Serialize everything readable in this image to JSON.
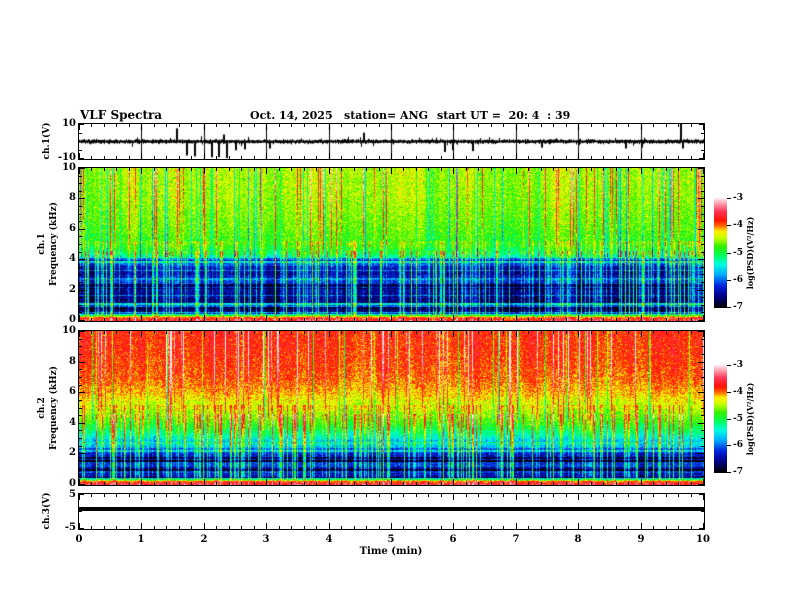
{
  "header": {
    "title": "VLF Spectra",
    "date": "Oct. 14, 2025",
    "station": "station= ANG",
    "start_ut": "start UT =  20: 4  : 39"
  },
  "xaxis": {
    "label": "Time (min)",
    "ticks": [
      "0",
      "1",
      "2",
      "3",
      "4",
      "5",
      "6",
      "7",
      "8",
      "9",
      "10"
    ]
  },
  "panels": {
    "ch1_wave": {
      "label": "ch.1(V)",
      "ytick_top": "10",
      "ytick_bottom": "-10"
    },
    "spec1": {
      "channel": "ch.1",
      "ylabel": "Frequency (kHz)",
      "yticks": [
        "10",
        "8",
        "6",
        "4",
        "2",
        "0"
      ]
    },
    "spec2": {
      "channel": "ch.2",
      "ylabel": "Frequency (kHz)",
      "yticks": [
        "10",
        "8",
        "6",
        "4",
        "2",
        "0"
      ]
    },
    "ch3": {
      "label": "ch.3(V)",
      "ytick_top": "5",
      "ytick_bottom": "-5"
    }
  },
  "colorbar": {
    "label": "log(PSD)(V²/Hz)",
    "ticks": [
      "-3",
      "-4",
      "-5",
      "-6",
      "-7"
    ],
    "value_range": [
      -7,
      -3
    ],
    "stops": [
      [
        0,
        "#000000"
      ],
      [
        0.1,
        "#000080"
      ],
      [
        0.2,
        "#0022dd"
      ],
      [
        0.3,
        "#00aaff"
      ],
      [
        0.4,
        "#00ffdd"
      ],
      [
        0.48,
        "#00ff55"
      ],
      [
        0.56,
        "#33ee00"
      ],
      [
        0.64,
        "#ccff00"
      ],
      [
        0.7,
        "#ffee00"
      ],
      [
        0.75,
        "#ff6600"
      ],
      [
        0.8,
        "#ff1100"
      ],
      [
        0.88,
        "#ff3355"
      ],
      [
        0.95,
        "#ff99aa"
      ],
      [
        1,
        "#ffe8ee"
      ]
    ]
  },
  "chart_data": [
    {
      "name": "ch1-waveform",
      "type": "line",
      "ylabel": "ch.1(V)",
      "xlim": [
        0,
        10
      ],
      "ylim": [
        -10,
        10
      ],
      "noise_amplitude_v": 1.4,
      "minute_gridlines": [
        1,
        2,
        3,
        4,
        5,
        6,
        7,
        8,
        9
      ],
      "spikes": [
        {
          "t": 1.55,
          "v": 7.5
        },
        {
          "t": 1.72,
          "v": -8
        },
        {
          "t": 1.85,
          "v": -8.5
        },
        {
          "t": 2.12,
          "v": -9
        },
        {
          "t": 2.22,
          "v": -9
        },
        {
          "t": 2.3,
          "v": 4
        },
        {
          "t": 2.35,
          "v": -9.5
        },
        {
          "t": 2.5,
          "v": -5
        },
        {
          "t": 2.65,
          "v": -4.5
        },
        {
          "t": 3.05,
          "v": -4
        },
        {
          "t": 4.55,
          "v": 5
        },
        {
          "t": 5.85,
          "v": -6
        },
        {
          "t": 5.97,
          "v": -5
        },
        {
          "t": 6.3,
          "v": -5.5
        },
        {
          "t": 7.4,
          "v": -3.5
        },
        {
          "t": 8.75,
          "v": -4
        },
        {
          "t": 9.0,
          "v": -3.5
        },
        {
          "t": 9.63,
          "v": 10
        },
        {
          "t": 9.66,
          "v": -4
        }
      ]
    },
    {
      "name": "ch1-spectrogram",
      "type": "heatmap",
      "xlim": [
        0,
        10
      ],
      "ylim": [
        0,
        10
      ],
      "value_range": [
        -7,
        -3
      ],
      "units": "log(PSD)(V²/Hz)",
      "seed": 11,
      "noise": 0.42,
      "dark_streak_p": 0.08,
      "banded_region_khz": [
        0.45,
        4.1
      ],
      "freq_profile": [
        [
          0,
          -3.7
        ],
        [
          0.22,
          -4.0
        ],
        [
          0.5,
          -6.1
        ],
        [
          1,
          -6.45
        ],
        [
          2,
          -6.5
        ],
        [
          3,
          -6.35
        ],
        [
          3.9,
          -5.9
        ],
        [
          4.4,
          -5.2
        ],
        [
          5,
          -4.85
        ],
        [
          6,
          -4.7
        ],
        [
          8,
          -4.55
        ],
        [
          10,
          -4.5
        ]
      ],
      "description": "Green/yellow background 4-10 kHz with red sferic streaks; dark blue banded region 0.5-4 kHz with cyan vertical streaks; bright band below 0.3 kHz"
    },
    {
      "name": "ch2-spectrogram",
      "type": "heatmap",
      "xlim": [
        0,
        10
      ],
      "ylim": [
        0,
        10
      ],
      "value_range": [
        -7,
        -3
      ],
      "units": "log(PSD)(V²/Hz)",
      "seed": 77,
      "noise": 0.4,
      "dark_streak_p": 0.04,
      "banded_region_khz": [
        0.45,
        3.0
      ],
      "freq_profile": [
        [
          0,
          -3.7
        ],
        [
          0.22,
          -4.0
        ],
        [
          0.5,
          -6.4
        ],
        [
          1.5,
          -6.55
        ],
        [
          2.4,
          -6.2
        ],
        [
          3.2,
          -5.5
        ],
        [
          4,
          -5.0
        ],
        [
          5,
          -4.5
        ],
        [
          6,
          -4.15
        ],
        [
          7,
          -3.95
        ],
        [
          8.5,
          -3.85
        ],
        [
          10,
          -3.8
        ]
      ],
      "description": "Red/orange dominated 5-10 kHz, green 3-5 kHz, dark banded region below 3 kHz with cyan streaks; bright band below 0.3 kHz"
    },
    {
      "name": "ch3-trace",
      "type": "line",
      "ylabel": "ch.3(V)",
      "xlim": [
        0,
        10
      ],
      "ylim": [
        -5,
        5
      ],
      "constant_value_v": 0.7,
      "line_thickness_px": 4
    }
  ]
}
